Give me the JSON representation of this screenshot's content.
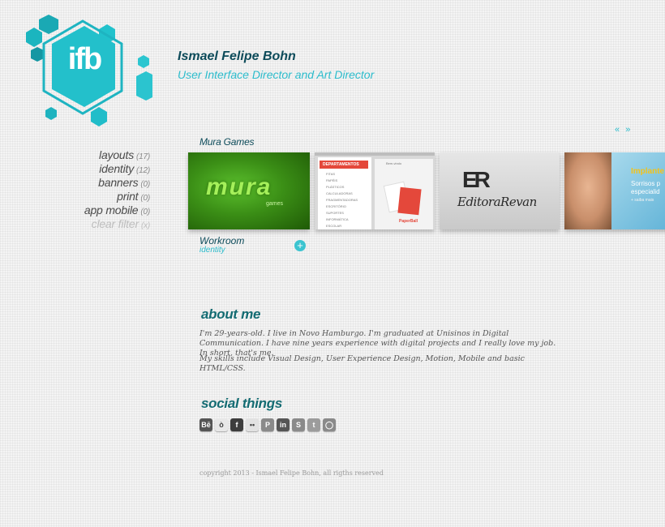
{
  "header": {
    "logo_text": "ifb",
    "name": "Ismael Felipe Bohn",
    "role": "User Interface Director and Art Director"
  },
  "filters": [
    {
      "label": "layouts",
      "count": "(17)"
    },
    {
      "label": "identity",
      "count": "(12)"
    },
    {
      "label": "banners",
      "count": "(0)"
    },
    {
      "label": "print",
      "count": "(0)"
    },
    {
      "label": "app mobile",
      "count": "(0)"
    },
    {
      "label": "clear filter",
      "count": "(x)"
    }
  ],
  "carousel": {
    "category_title": "Mura Games",
    "prev_arrow": "«",
    "next_arrow": "»",
    "cards": [
      {
        "logo_text": "mura",
        "sub_text": "games"
      },
      {
        "menu_header": "DEPARTAMENTOS",
        "menu_items": [
          "FITAS",
          "PAPÉIS",
          "PLÁSTICOS",
          "CALCULADORAS",
          "FRAGMENTADORAS",
          "ESCRITÓRIO",
          "SUPORTES",
          "INFORMÁTICA",
          "ESCOLAR"
        ],
        "login_text": "Bem-vindo",
        "brand_text": "PaperBall"
      },
      {
        "mark_text": "ER",
        "brand_text": "EditoraRevan"
      },
      {
        "headline": "Implante",
        "subline_1": "Sorrisos p",
        "subline_2": "especialid",
        "link": "+ saiba mais"
      }
    ],
    "project_title": "Workroom",
    "project_tag": "identity",
    "plus_label": "+"
  },
  "about": {
    "heading": "about me",
    "paragraph_1": "I'm 29-years-old. I live in Novo Hamburgo. I'm graduated at Unisinos in Digital Communication. I have nine years experience with digital projects and I really love my job. In short, that's me.",
    "paragraph_2": "My skills include Visual Design, User Experience Design, Motion, Mobile and basic HTML/CSS."
  },
  "social": {
    "heading": "social things",
    "icons": [
      {
        "name": "behance-icon",
        "glyph": "Bē",
        "color": "#555555"
      },
      {
        "name": "bike-icon",
        "glyph": "ò",
        "color": "#e8e8e8"
      },
      {
        "name": "facebook-icon",
        "glyph": "f",
        "color": "#3d3d3d"
      },
      {
        "name": "flickr-icon",
        "glyph": "••",
        "color": "#e2e2e2"
      },
      {
        "name": "pinterest-icon",
        "glyph": "P",
        "color": "#8a8a8a"
      },
      {
        "name": "linkedin-icon",
        "glyph": "in",
        "color": "#555555"
      },
      {
        "name": "skype-icon",
        "glyph": "S",
        "color": "#8a8a8a"
      },
      {
        "name": "twitter-icon",
        "glyph": "t",
        "color": "#9c9c9c"
      },
      {
        "name": "chat-icon",
        "glyph": "◯",
        "color": "#8a8a8a"
      }
    ]
  },
  "footer": {
    "copyright": "copyright 2013 - Ismael Felipe Bohn, all rigths reserved"
  },
  "colors": {
    "accent": "#2cbccc",
    "dark_teal": "#0d4b5a",
    "logo_teal": "#24c1cc"
  }
}
